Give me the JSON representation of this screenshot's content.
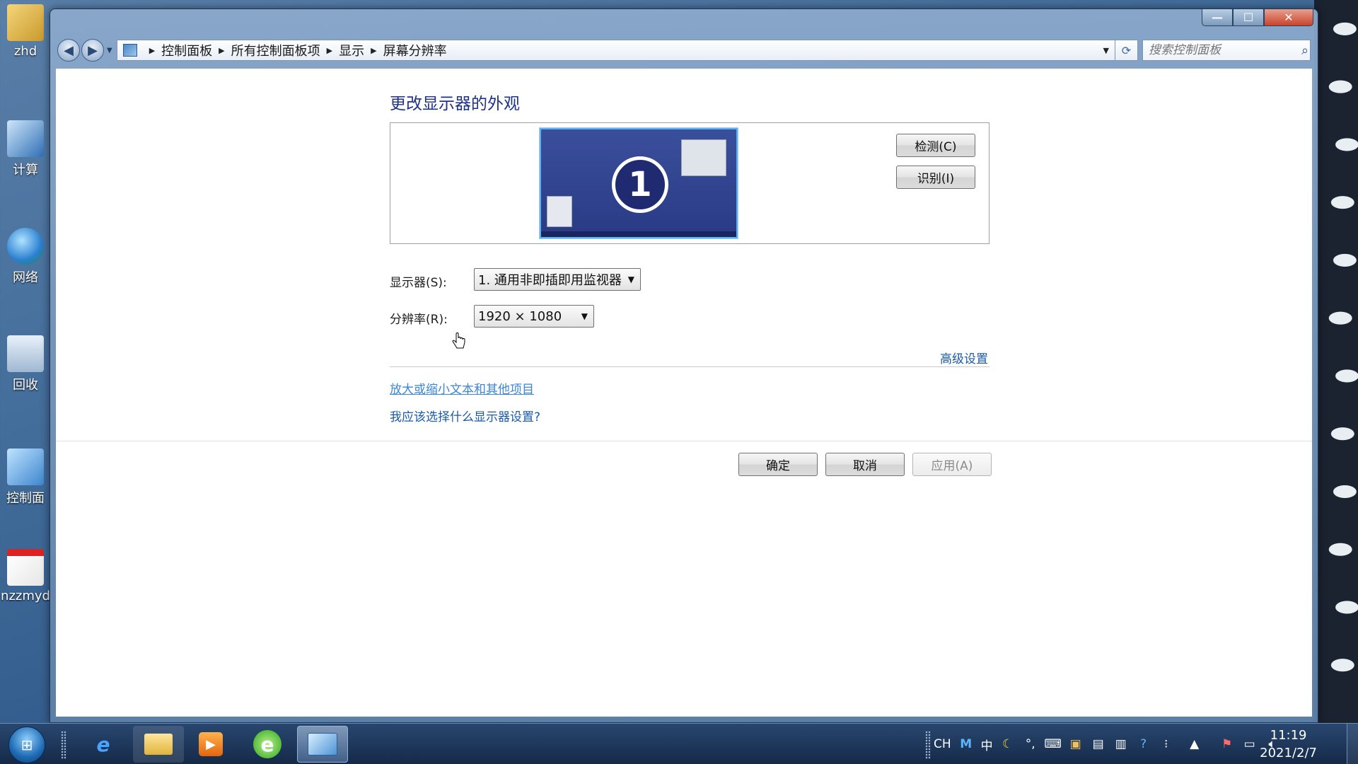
{
  "desktop": {
    "icons": [
      {
        "label": "zhd",
        "icon": "user-folder-icon"
      },
      {
        "label": "计算",
        "icon": "computer-icon"
      },
      {
        "label": "网络",
        "icon": "network-icon"
      },
      {
        "label": "回收",
        "icon": "recycle-bin-icon"
      },
      {
        "label": "控制面",
        "icon": "control-panel-icon"
      },
      {
        "label": "nzzmyd",
        "icon": "pdf-file-icon"
      }
    ]
  },
  "window": {
    "controls": {
      "minimize": "—",
      "maximize": "☐",
      "close": "✕"
    }
  },
  "address": {
    "breadcrumbs": [
      "控制面板",
      "所有控制面板项",
      "显示",
      "屏幕分辨率"
    ],
    "search_placeholder": "搜索控制面板"
  },
  "page": {
    "title": "更改显示器的外观",
    "monitor_number": "1",
    "detect_button": "检测(C)",
    "identify_button": "识别(I)",
    "display_label": "显示器(S):",
    "display_value": "1. 通用非即插即用监视器",
    "resolution_label": "分辨率(R):",
    "resolution_value": "1920 × 1080",
    "advanced_link": "高级设置",
    "link_text_size": "放大或缩小文本和其他项目",
    "link_which_settings": "我应该选择什么显示器设置?",
    "ok_button": "确定",
    "cancel_button": "取消",
    "apply_button": "应用(A)"
  },
  "taskbar": {
    "tray": {
      "ime_lang": "CH",
      "ime_mode": "中"
    },
    "clock": {
      "time": "11:19",
      "date": "2021/2/7"
    }
  },
  "colors": {
    "title_color": "#1e3287",
    "link_color": "#1a5aa8",
    "window_glass": "#8aaacd",
    "taskbar": "#1c3a62"
  }
}
